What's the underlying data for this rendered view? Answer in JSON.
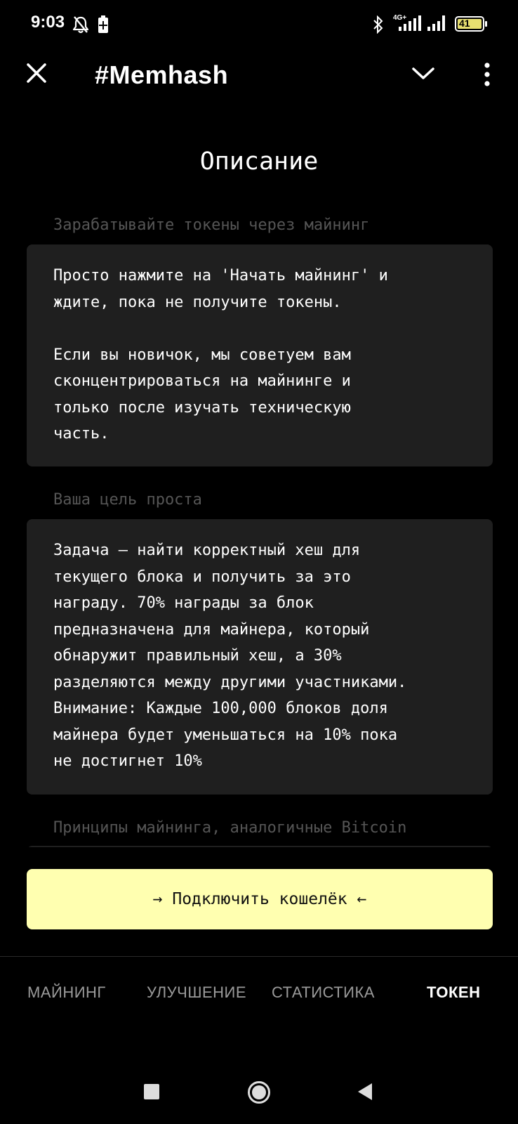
{
  "status_bar": {
    "time": "9:03",
    "battery": "41",
    "network_label": "4G+",
    "icons": [
      "mute-bell-icon",
      "battery-saver-icon",
      "bluetooth-icon",
      "signal-icon",
      "signal-icon",
      "battery-icon"
    ]
  },
  "header": {
    "title": "#Memhash",
    "icons": [
      "close-icon",
      "chevron-down-icon",
      "more-vertical-icon"
    ]
  },
  "content": {
    "page_title": "Описание",
    "sections": [
      {
        "label": "Зарабатывайте токены через майнинг",
        "paragraphs": [
          "Просто нажмите на 'Начать майнинг' и\nждите, пока не получите токены.",
          "Если вы новичок, мы советуем вам\nсконцентрироваться на майнинге и\nтолько после изучать техническую\nчасть."
        ]
      },
      {
        "label": "Ваша цель проста",
        "paragraphs": [
          "Задача — найти корректный хеш для\nтекущего блока и получить за это\nнаграду. 70% награды за блок\nпредназначена для майнера, который\nобнаружит правильный хеш, а 30%\nразделяются между другими участниками.\nВнимание: Каждые 100,000 блоков доля\nмайнера будет уменьшаться на 10% пока\nне достигнет 10%"
        ]
      },
      {
        "label": "Принципы майнинга, аналогичные Bitcoin"
      }
    ]
  },
  "connect_button": {
    "label": "→ Подключить кошелёк ←"
  },
  "tabs": {
    "items": [
      {
        "label": "МАЙНИНГ",
        "active": false
      },
      {
        "label": "УЛУЧШЕНИЕ",
        "active": false
      },
      {
        "label": "СТАТИСТИКА",
        "active": false
      },
      {
        "label": "ТОКЕН",
        "active": true
      }
    ]
  },
  "system_nav": {
    "icons": [
      "recent-apps-icon",
      "home-icon",
      "back-icon"
    ]
  },
  "colors": {
    "background": "#000000",
    "card": "#1f1f1f",
    "accent_button": "#ffffb0",
    "muted_text": "#555555",
    "tab_inactive": "#9a9a9a"
  }
}
